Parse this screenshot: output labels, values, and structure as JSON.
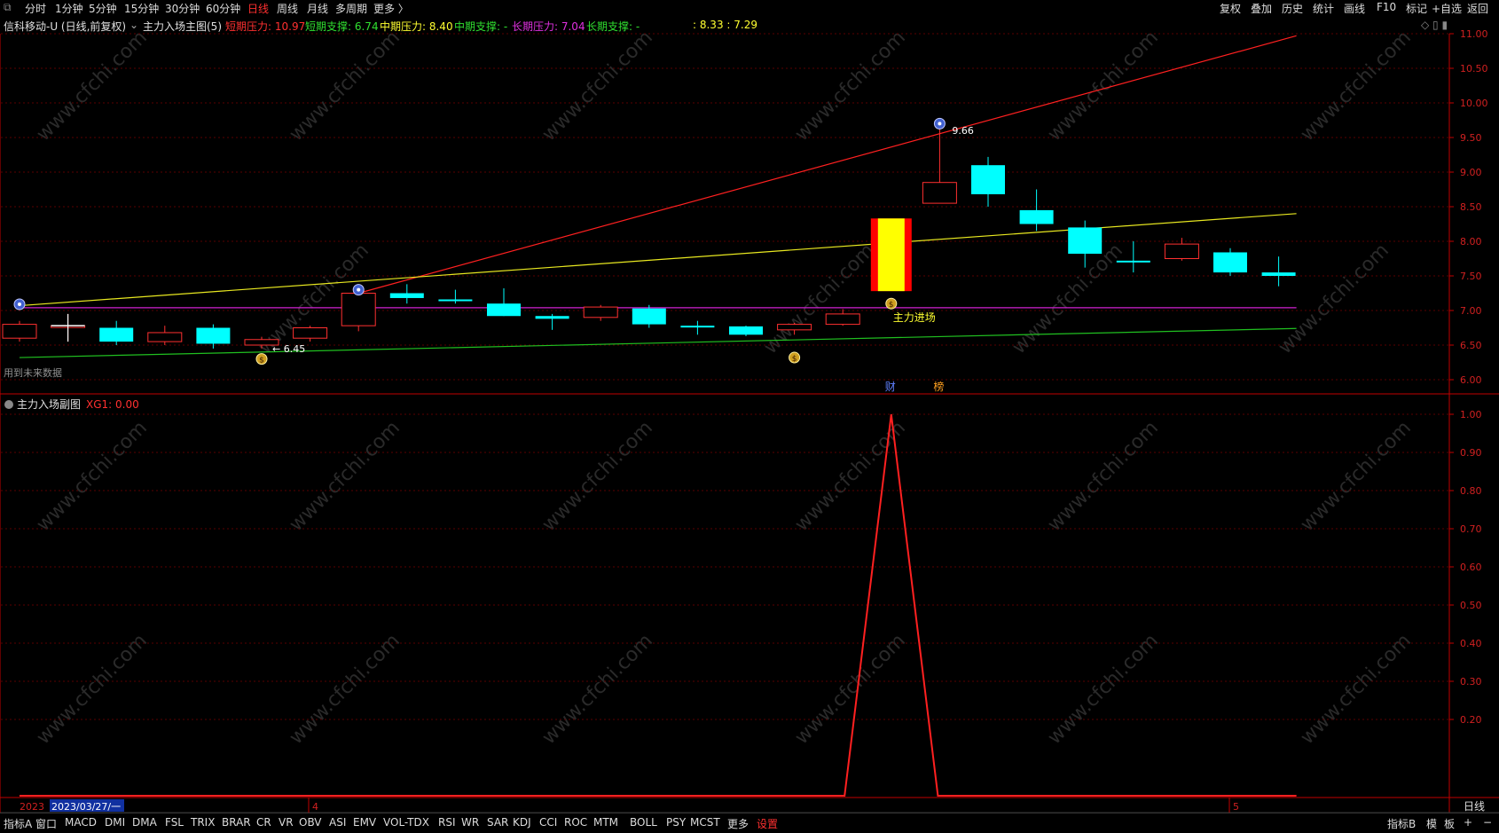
{
  "toolbar": {
    "left": [
      "分时",
      "1分钟",
      "5分钟",
      "15分钟",
      "30分钟",
      "60分钟",
      "日线",
      "周线",
      "月线",
      "多周期",
      "更多 〉"
    ],
    "active_index": 6,
    "right": [
      "复权",
      "叠加",
      "历史",
      "统计",
      "画线",
      "F10",
      "标记",
      "+自选",
      "返回"
    ]
  },
  "info": {
    "stock": "信科移动-U (日线,前复权)",
    "indicator": "主力入场主图(5)",
    "items": [
      {
        "label": "短期压力:",
        "value": "10.97",
        "color": "#ff3030"
      },
      {
        "label": "短期支撑:",
        "value": "6.74",
        "color": "#30e030"
      },
      {
        "label": "中期压力:",
        "value": "8.40",
        "color": "#ffff30"
      },
      {
        "label": "中期支撑:",
        "value": "-",
        "color": "#30e030"
      },
      {
        "label": "长期压力:",
        "value": "7.04",
        "color": "#e030e0"
      },
      {
        "label": "长期支撑:",
        "value": "-",
        "color": "#30e030"
      }
    ],
    "extra": ": 8.33 : 7.29"
  },
  "colors": {
    "up": "#ff3030",
    "down": "#00ffff",
    "grid": "#5a0000",
    "axis": "#c00000",
    "short_line": "#ff2020",
    "mid_line": "#e8e820",
    "long_line": "#d020d0",
    "support_line": "#20c020"
  },
  "main_chart": {
    "ylim": [
      5.9,
      11.1
    ],
    "yticks": [
      "11.00",
      "10.50",
      "10.00",
      "9.50",
      "9.00",
      "8.50",
      "8.00",
      "7.50",
      "7.00",
      "6.50",
      "6.00"
    ],
    "annotations": {
      "high_label": "9.66",
      "low_label": "6.45",
      "entry_label": "主力进场",
      "future_note": "用到未来数据",
      "cai_label": "财",
      "bang_label": "榜"
    }
  },
  "chart_data": [
    {
      "type": "candlestick",
      "title": "信科移动-U (日线,前复权)",
      "ylim": [
        5.9,
        11.1
      ],
      "candles": [
        {
          "o": 6.6,
          "c": 6.8,
          "h": 6.85,
          "l": 6.55
        },
        {
          "o": 6.78,
          "c": 6.78,
          "h": 6.95,
          "l": 6.55
        },
        {
          "o": 6.75,
          "c": 6.55,
          "h": 6.85,
          "l": 6.5
        },
        {
          "o": 6.55,
          "c": 6.68,
          "h": 6.78,
          "l": 6.5
        },
        {
          "o": 6.75,
          "c": 6.52,
          "h": 6.8,
          "l": 6.45
        },
        {
          "o": 6.5,
          "c": 6.58,
          "h": 6.62,
          "l": 6.45
        },
        {
          "o": 6.6,
          "c": 6.75,
          "h": 6.78,
          "l": 6.55
        },
        {
          "o": 6.78,
          "c": 7.25,
          "h": 7.3,
          "l": 6.7
        },
        {
          "o": 7.25,
          "c": 7.18,
          "h": 7.38,
          "l": 7.1
        },
        {
          "o": 7.16,
          "c": 7.14,
          "h": 7.3,
          "l": 7.1
        },
        {
          "o": 7.1,
          "c": 6.92,
          "h": 7.32,
          "l": 6.92
        },
        {
          "o": 6.92,
          "c": 6.88,
          "h": 6.95,
          "l": 6.72
        },
        {
          "o": 6.9,
          "c": 7.05,
          "h": 7.08,
          "l": 6.85
        },
        {
          "o": 7.03,
          "c": 6.8,
          "h": 7.08,
          "l": 6.75
        },
        {
          "o": 6.78,
          "c": 6.76,
          "h": 6.85,
          "l": 6.65
        },
        {
          "o": 6.77,
          "c": 6.65,
          "h": 6.78,
          "l": 6.63
        },
        {
          "o": 6.72,
          "c": 6.8,
          "h": 6.82,
          "l": 6.65
        },
        {
          "o": 6.8,
          "c": 6.95,
          "h": 7.02,
          "l": 6.78
        },
        {
          "o": 7.28,
          "c": 8.33,
          "h": 8.33,
          "l": 7.28
        },
        {
          "o": 8.55,
          "c": 8.85,
          "h": 9.66,
          "l": 8.55
        },
        {
          "o": 9.1,
          "c": 8.68,
          "h": 9.22,
          "l": 8.5
        },
        {
          "o": 8.45,
          "c": 8.25,
          "h": 8.75,
          "l": 8.15
        },
        {
          "o": 8.2,
          "c": 7.82,
          "h": 8.3,
          "l": 7.62
        },
        {
          "o": 7.72,
          "c": 7.7,
          "h": 8.0,
          "l": 7.55
        },
        {
          "o": 7.75,
          "c": 7.96,
          "h": 8.05,
          "l": 7.72
        },
        {
          "o": 7.84,
          "c": 7.55,
          "h": 7.9,
          "l": 7.5
        },
        {
          "o": 7.55,
          "c": 7.5,
          "h": 7.78,
          "l": 7.35
        }
      ],
      "lines": [
        {
          "name": "短期压力",
          "color": "#ff2020",
          "points": [
            [
              7,
              7.25
            ],
            [
              26,
              10.97
            ]
          ]
        },
        {
          "name": "中期压力",
          "color": "#e8e820",
          "points": [
            [
              0,
              7.07
            ],
            [
              26,
              8.4
            ]
          ]
        },
        {
          "name": "长期压力",
          "color": "#d020d0",
          "points": [
            [
              0,
              7.04
            ],
            [
              26,
              7.04
            ]
          ]
        },
        {
          "name": "短期支撑",
          "color": "#20c020",
          "points": [
            [
              0,
              6.32
            ],
            [
              26,
              6.74
            ]
          ]
        }
      ]
    },
    {
      "type": "line",
      "title": "主力入场副图",
      "series": [
        {
          "name": "XG1",
          "values": [
            0,
            0,
            0,
            0,
            0,
            0,
            0,
            0,
            0,
            0,
            0,
            0,
            0,
            0,
            0,
            0,
            0,
            0,
            1,
            0,
            0,
            0,
            0,
            0,
            0,
            0,
            0
          ]
        }
      ],
      "ylim": [
        0,
        1.0
      ],
      "yticks": [
        "1.00",
        "0.90",
        "0.80",
        "0.70",
        "0.60",
        "0.50",
        "0.40",
        "0.30",
        "0.20"
      ]
    }
  ],
  "sub_chart": {
    "title": "主力入场副图",
    "value_label": "XG1: 0.00"
  },
  "xaxis": {
    "left_label": "2023/03/27/一",
    "year_label": "2023",
    "month_labels": [
      "4",
      "5"
    ],
    "period_label": "日线"
  },
  "bottom": {
    "items": [
      "指标A",
      "窗口",
      "MACD",
      "DMI",
      "DMA",
      "FSL",
      "TRIX",
      "BRAR",
      "CR",
      "VR",
      "OBV",
      "ASI",
      "EMV",
      "VOL-TDX",
      "RSI",
      "WR",
      "SAR",
      "KDJ",
      "CCI",
      "ROC",
      "MTM",
      "BOLL",
      "PSY",
      "MCST",
      "更多",
      "设置"
    ],
    "active_index": 25,
    "right": [
      "指标B",
      "模",
      "板",
      "+",
      "−"
    ]
  },
  "watermark": "www.cfchi.com"
}
